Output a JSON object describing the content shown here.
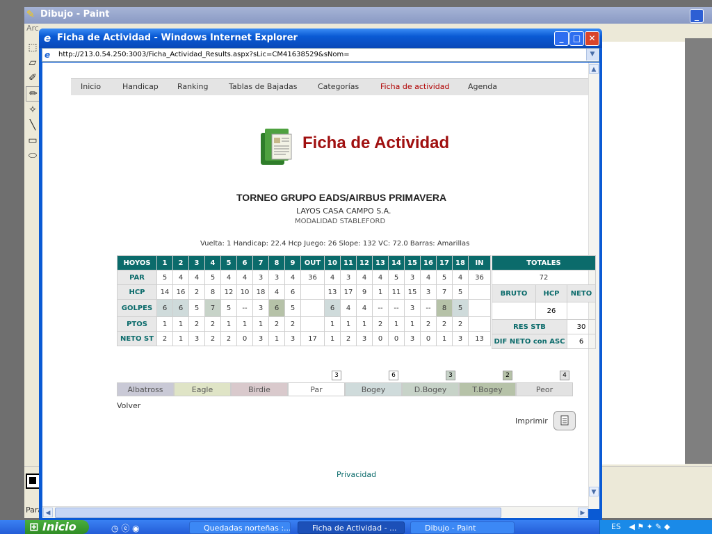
{
  "paint": {
    "title": "Dibujo - Paint",
    "menu_fragment": "Arc",
    "status_fragment": "Para"
  },
  "ie": {
    "title": "Ficha de Actividad - Windows Internet Explorer",
    "url": "http://213.0.54.250:3003/Ficha_Actividad_Results.aspx?sLic=CM41638529&sNom="
  },
  "nav": {
    "items": [
      "Inicio",
      "Handicap",
      "Ranking",
      "Tablas de Bajadas",
      "Categorías",
      "Ficha de actividad",
      "Agenda"
    ],
    "active": "Ficha de actividad"
  },
  "page": {
    "title": "Ficha de Actividad",
    "tournament": "TORNEO GRUPO EADS/AIRBUS PRIMAVERA",
    "club": "LAYOS CASA CAMPO S.A.",
    "modality": "MODALIDAD STABLEFORD",
    "round_info": "Vuelta: 1 Handicap: 22.4   Hcp Juego: 26   Slope: 132   VC: 72.0   Barras: Amarillas"
  },
  "scorecard": {
    "headers": [
      "HOYOS",
      "1",
      "2",
      "3",
      "4",
      "5",
      "6",
      "7",
      "8",
      "9",
      "OUT",
      "10",
      "11",
      "12",
      "13",
      "14",
      "15",
      "16",
      "17",
      "18",
      "IN"
    ],
    "totals_header": "TOTALES",
    "rows": [
      {
        "label": "PAR",
        "cells": [
          "5",
          "4",
          "4",
          "5",
          "4",
          "4",
          "3",
          "3",
          "4",
          "36",
          "4",
          "3",
          "4",
          "4",
          "5",
          "3",
          "4",
          "5",
          "4",
          "36"
        ]
      },
      {
        "label": "HCP",
        "cells": [
          "14",
          "16",
          "2",
          "8",
          "12",
          "10",
          "18",
          "4",
          "6",
          "",
          "13",
          "17",
          "9",
          "1",
          "11",
          "15",
          "3",
          "7",
          "5",
          ""
        ]
      },
      {
        "label": "GOLPES",
        "cells": [
          "6",
          "6",
          "5",
          "7",
          "5",
          "--",
          "3",
          "6",
          "5",
          "",
          "6",
          "4",
          "4",
          "--",
          "--",
          "3",
          "--",
          "8",
          "5",
          ""
        ]
      },
      {
        "label": "PTOS",
        "cells": [
          "1",
          "1",
          "2",
          "2",
          "1",
          "1",
          "1",
          "2",
          "2",
          "",
          "1",
          "1",
          "1",
          "2",
          "1",
          "1",
          "2",
          "2",
          "2",
          ""
        ]
      },
      {
        "label": "NETO ST",
        "cells": [
          "2",
          "1",
          "3",
          "2",
          "2",
          "0",
          "3",
          "1",
          "3",
          "17",
          "1",
          "2",
          "3",
          "0",
          "0",
          "3",
          "0",
          "1",
          "3",
          "13"
        ]
      }
    ],
    "golpes_classes": [
      "bogey",
      "bogey",
      "par",
      "dbogey",
      "par",
      "",
      "par",
      "tbogey",
      "par",
      "",
      "bogey",
      "par",
      "par",
      "",
      "",
      "par",
      "",
      "tbogey",
      "bogey",
      ""
    ],
    "totals": {
      "par_total": "72",
      "cols": [
        "BRUTO",
        "HCP",
        "NETO"
      ],
      "golpes_hcp": "26",
      "res_stb_label": "RES STB",
      "res_stb_value": "30",
      "dif_label": "DIF NETO con ASC",
      "dif_value": "6"
    }
  },
  "legend": {
    "items": [
      {
        "label": "Albatross",
        "count": "",
        "color": "#c9c9d6"
      },
      {
        "label": "Eagle",
        "count": "",
        "color": "#dfe4c6"
      },
      {
        "label": "Birdie",
        "count": "",
        "color": "#d9c9cc"
      },
      {
        "label": "Par",
        "count": "3",
        "color": "#ffffff"
      },
      {
        "label": "Bogey",
        "count": "6",
        "color": "#cfdbdb"
      },
      {
        "label": "D.Bogey",
        "count": "3",
        "color": "#c7d3c8"
      },
      {
        "label": "T.Bogey",
        "count": "2",
        "color": "#b6c2a8"
      },
      {
        "label": "Peor",
        "count": "4",
        "color": "#e2e2e2"
      }
    ]
  },
  "actions": {
    "back": "Volver",
    "print": "Imprimir",
    "privacy": "Privacidad"
  },
  "taskbar": {
    "start": "Inicio",
    "tasks": [
      "Quedadas norteñas :...",
      "Ficha de Actividad - ...",
      "Dibujo - Paint"
    ],
    "lang": "ES"
  }
}
